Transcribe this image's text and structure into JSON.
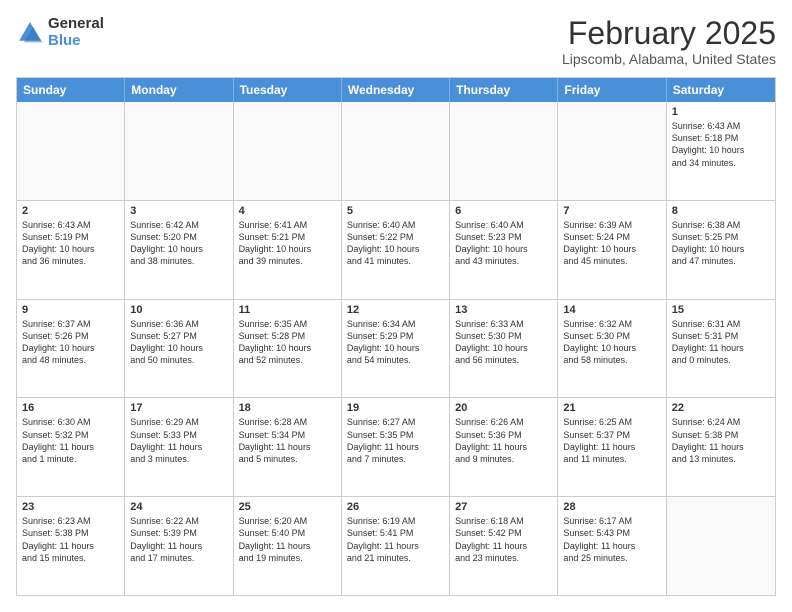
{
  "logo": {
    "general": "General",
    "blue": "Blue"
  },
  "header": {
    "title": "February 2025",
    "subtitle": "Lipscomb, Alabama, United States"
  },
  "days": [
    "Sunday",
    "Monday",
    "Tuesday",
    "Wednesday",
    "Thursday",
    "Friday",
    "Saturday"
  ],
  "weeks": [
    [
      {
        "num": "",
        "text": "",
        "empty": true
      },
      {
        "num": "",
        "text": "",
        "empty": true
      },
      {
        "num": "",
        "text": "",
        "empty": true
      },
      {
        "num": "",
        "text": "",
        "empty": true
      },
      {
        "num": "",
        "text": "",
        "empty": true
      },
      {
        "num": "",
        "text": "",
        "empty": true
      },
      {
        "num": "1",
        "text": "Sunrise: 6:43 AM\nSunset: 5:18 PM\nDaylight: 10 hours\nand 34 minutes.",
        "empty": false
      }
    ],
    [
      {
        "num": "2",
        "text": "Sunrise: 6:43 AM\nSunset: 5:19 PM\nDaylight: 10 hours\nand 36 minutes.",
        "empty": false
      },
      {
        "num": "3",
        "text": "Sunrise: 6:42 AM\nSunset: 5:20 PM\nDaylight: 10 hours\nand 38 minutes.",
        "empty": false
      },
      {
        "num": "4",
        "text": "Sunrise: 6:41 AM\nSunset: 5:21 PM\nDaylight: 10 hours\nand 39 minutes.",
        "empty": false
      },
      {
        "num": "5",
        "text": "Sunrise: 6:40 AM\nSunset: 5:22 PM\nDaylight: 10 hours\nand 41 minutes.",
        "empty": false
      },
      {
        "num": "6",
        "text": "Sunrise: 6:40 AM\nSunset: 5:23 PM\nDaylight: 10 hours\nand 43 minutes.",
        "empty": false
      },
      {
        "num": "7",
        "text": "Sunrise: 6:39 AM\nSunset: 5:24 PM\nDaylight: 10 hours\nand 45 minutes.",
        "empty": false
      },
      {
        "num": "8",
        "text": "Sunrise: 6:38 AM\nSunset: 5:25 PM\nDaylight: 10 hours\nand 47 minutes.",
        "empty": false
      }
    ],
    [
      {
        "num": "9",
        "text": "Sunrise: 6:37 AM\nSunset: 5:26 PM\nDaylight: 10 hours\nand 48 minutes.",
        "empty": false
      },
      {
        "num": "10",
        "text": "Sunrise: 6:36 AM\nSunset: 5:27 PM\nDaylight: 10 hours\nand 50 minutes.",
        "empty": false
      },
      {
        "num": "11",
        "text": "Sunrise: 6:35 AM\nSunset: 5:28 PM\nDaylight: 10 hours\nand 52 minutes.",
        "empty": false
      },
      {
        "num": "12",
        "text": "Sunrise: 6:34 AM\nSunset: 5:29 PM\nDaylight: 10 hours\nand 54 minutes.",
        "empty": false
      },
      {
        "num": "13",
        "text": "Sunrise: 6:33 AM\nSunset: 5:30 PM\nDaylight: 10 hours\nand 56 minutes.",
        "empty": false
      },
      {
        "num": "14",
        "text": "Sunrise: 6:32 AM\nSunset: 5:30 PM\nDaylight: 10 hours\nand 58 minutes.",
        "empty": false
      },
      {
        "num": "15",
        "text": "Sunrise: 6:31 AM\nSunset: 5:31 PM\nDaylight: 11 hours\nand 0 minutes.",
        "empty": false
      }
    ],
    [
      {
        "num": "16",
        "text": "Sunrise: 6:30 AM\nSunset: 5:32 PM\nDaylight: 11 hours\nand 1 minute.",
        "empty": false
      },
      {
        "num": "17",
        "text": "Sunrise: 6:29 AM\nSunset: 5:33 PM\nDaylight: 11 hours\nand 3 minutes.",
        "empty": false
      },
      {
        "num": "18",
        "text": "Sunrise: 6:28 AM\nSunset: 5:34 PM\nDaylight: 11 hours\nand 5 minutes.",
        "empty": false
      },
      {
        "num": "19",
        "text": "Sunrise: 6:27 AM\nSunset: 5:35 PM\nDaylight: 11 hours\nand 7 minutes.",
        "empty": false
      },
      {
        "num": "20",
        "text": "Sunrise: 6:26 AM\nSunset: 5:36 PM\nDaylight: 11 hours\nand 9 minutes.",
        "empty": false
      },
      {
        "num": "21",
        "text": "Sunrise: 6:25 AM\nSunset: 5:37 PM\nDaylight: 11 hours\nand 11 minutes.",
        "empty": false
      },
      {
        "num": "22",
        "text": "Sunrise: 6:24 AM\nSunset: 5:38 PM\nDaylight: 11 hours\nand 13 minutes.",
        "empty": false
      }
    ],
    [
      {
        "num": "23",
        "text": "Sunrise: 6:23 AM\nSunset: 5:38 PM\nDaylight: 11 hours\nand 15 minutes.",
        "empty": false
      },
      {
        "num": "24",
        "text": "Sunrise: 6:22 AM\nSunset: 5:39 PM\nDaylight: 11 hours\nand 17 minutes.",
        "empty": false
      },
      {
        "num": "25",
        "text": "Sunrise: 6:20 AM\nSunset: 5:40 PM\nDaylight: 11 hours\nand 19 minutes.",
        "empty": false
      },
      {
        "num": "26",
        "text": "Sunrise: 6:19 AM\nSunset: 5:41 PM\nDaylight: 11 hours\nand 21 minutes.",
        "empty": false
      },
      {
        "num": "27",
        "text": "Sunrise: 6:18 AM\nSunset: 5:42 PM\nDaylight: 11 hours\nand 23 minutes.",
        "empty": false
      },
      {
        "num": "28",
        "text": "Sunrise: 6:17 AM\nSunset: 5:43 PM\nDaylight: 11 hours\nand 25 minutes.",
        "empty": false
      },
      {
        "num": "",
        "text": "",
        "empty": true
      }
    ]
  ]
}
